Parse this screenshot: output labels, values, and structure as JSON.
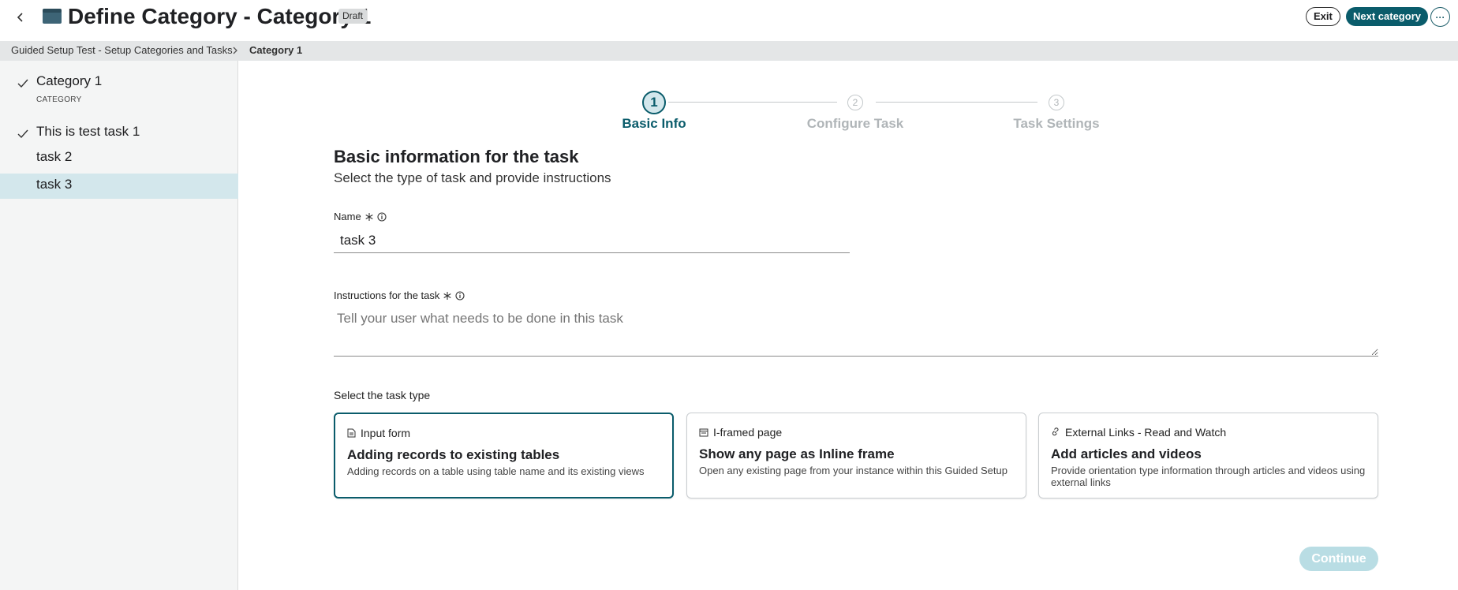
{
  "header": {
    "title": "Define Category - Category 1",
    "badge": "Draft",
    "exit_label": "Exit",
    "next_label": "Next category",
    "more_label": "···"
  },
  "breadcrumb": {
    "items": [
      "Guided Setup Test - Setup Categories and Tasks",
      "Category 1"
    ]
  },
  "sidebar": {
    "category": {
      "label": "Category 1",
      "sub": "CATEGORY"
    },
    "items": [
      {
        "label": "This is test task 1",
        "done": true
      },
      {
        "label": "task 2",
        "done": false
      },
      {
        "label": "task 3",
        "done": false,
        "active": true
      }
    ]
  },
  "stepper": {
    "steps": [
      {
        "num": "1",
        "label": "Basic Info",
        "state": "active"
      },
      {
        "num": "2",
        "label": "Configure Task",
        "state": "pending"
      },
      {
        "num": "3",
        "label": "Task Settings",
        "state": "pending"
      }
    ]
  },
  "form": {
    "title": "Basic information for the task",
    "subtitle": "Select the type of task and provide instructions",
    "name_label": "Name",
    "name_value": "task 3",
    "instructions_label": "Instructions for the task",
    "instructions_placeholder": "Tell your user what needs to be done in this task",
    "type_label": "Select the task type"
  },
  "cards": [
    {
      "head": "Input form",
      "title": "Adding records to existing tables",
      "desc": "Adding records on a table using table name and its existing views",
      "selected": true
    },
    {
      "head": "I-framed page",
      "title": "Show any page as Inline frame",
      "desc": "Open any existing page from your instance within this Guided Setup",
      "selected": false
    },
    {
      "head": "External Links - Read and Watch",
      "title": "Add articles and videos",
      "desc": "Provide orientation type information through articles and videos using external links",
      "selected": false
    }
  ],
  "footer": {
    "continue_label": "Continue"
  },
  "colors": {
    "accent": "#0a5c6b",
    "active_row": "#d3e7ec",
    "disabled_button": "#b9dde4"
  }
}
